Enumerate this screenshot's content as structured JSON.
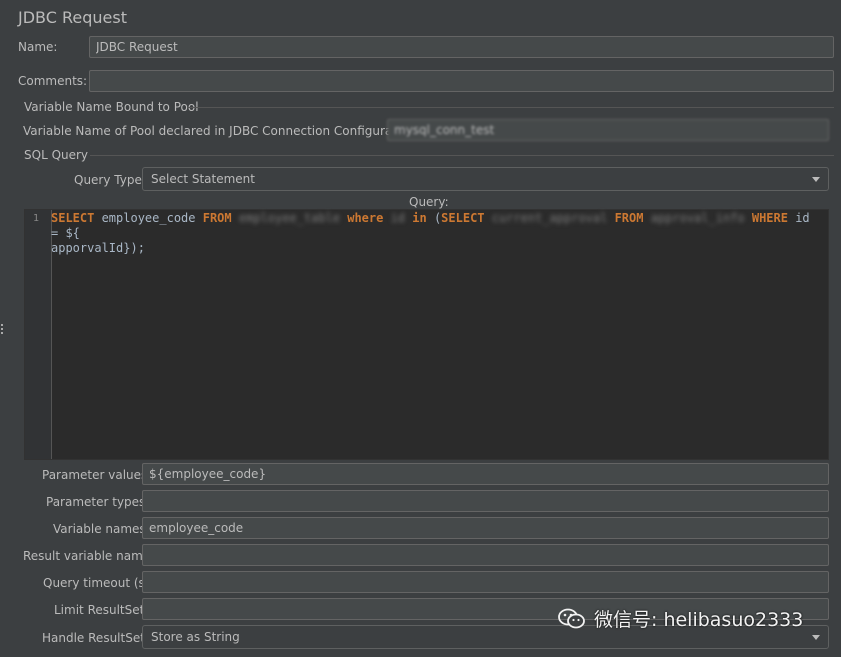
{
  "panel": {
    "title": "JDBC Request",
    "name_label": "Name:",
    "name_value": "JDBC Request",
    "comments_label": "Comments:",
    "comments_value": ""
  },
  "pool_section": {
    "title": "Variable Name Bound to Pool",
    "pool_label": "Variable Name of Pool declared in JDBC Connection Configuration:",
    "pool_value": "mysql_conn_test"
  },
  "sql_section": {
    "title": "SQL Query",
    "query_type_label": "Query Type:",
    "query_type_value": "Select Statement",
    "query_label": "Query:",
    "line_number": "1",
    "code": {
      "t1": "SELECT",
      "t2": " employee_code ",
      "t3": "FROM",
      "t4": " employee_table ",
      "t5": "where",
      "t6": " id ",
      "t7": "in",
      "t8": " (",
      "t9": "SELECT",
      "t10": " current_approval ",
      "t11": "FROM",
      "t12": " approval_info ",
      "t13": "WHERE",
      "t14": " id = ${",
      "t15": "apporvalId});"
    }
  },
  "params": {
    "parameter_values_label": "Parameter values:",
    "parameter_values": "${employee_code}",
    "parameter_types_label": "Parameter types:",
    "parameter_types": "",
    "variable_names_label": "Variable names:",
    "variable_names": "employee_code",
    "result_variable_label": "Result variable name:",
    "result_variable": "",
    "query_timeout_label": "Query timeout (s):",
    "query_timeout": "",
    "limit_resultset_label": "Limit ResultSet:",
    "limit_resultset": "",
    "handle_resultset_label": "Handle ResultSet:",
    "handle_resultset_value": "Store as String"
  },
  "watermark": {
    "text": "微信号: helibasuo2333",
    "icon": "wechat-icon"
  },
  "colors": {
    "background": "#3c3f41",
    "editor_background": "#2b2b2b",
    "keyword": "#cc7832",
    "code_text": "#a9b7c6"
  }
}
